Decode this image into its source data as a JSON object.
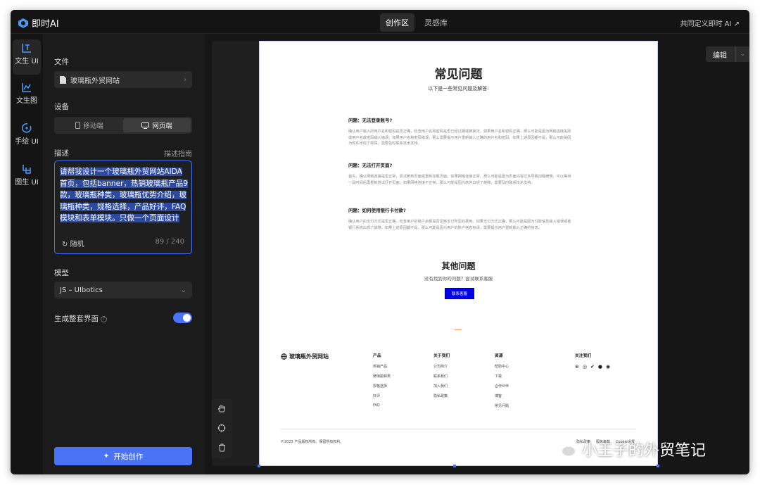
{
  "app": {
    "title": "即时AI",
    "accent": "#4a72f5"
  },
  "topbar": {
    "tabs": [
      {
        "label": "创作区",
        "active": true
      },
      {
        "label": "灵感库",
        "active": false
      }
    ],
    "right_link": "共同定义即时 AI ↗"
  },
  "nav": {
    "items": [
      {
        "label": "文生 UI",
        "icon": "text-ui-icon",
        "active": true
      },
      {
        "label": "文生图",
        "icon": "image-chart-icon",
        "active": false
      },
      {
        "label": "手绘 UI",
        "icon": "sketch-icon",
        "active": false
      },
      {
        "label": "图生 UI",
        "icon": "image-ui-icon",
        "active": false
      }
    ]
  },
  "panel": {
    "file_label": "文件",
    "file_value": "玻璃瓶外贸网站",
    "device_label": "设备",
    "device_options": [
      {
        "label": "移动端",
        "active": false
      },
      {
        "label": "网页端",
        "active": true
      }
    ],
    "desc_label": "描述",
    "desc_guide": "描述指南",
    "desc_text": "请帮我设计一个玻璃瓶外贸网站AIDA首页，包括banner，热销玻璃瓶产品9款，玻璃瓶种类，玻璃瓶优势介绍，玻璃瓶种类，规格选择，产品好评，FAQ模块和表单模块。只做一个页面设计",
    "random_label": "随机",
    "char_count": "89 / 240",
    "model_label": "模型",
    "model_value": "JS – UIbotics",
    "full_ui_label": "生成整套界面",
    "full_ui_enabled": true,
    "start_button": "开始创作"
  },
  "canvas": {
    "edit_button": "编辑",
    "tools": [
      "hand-icon",
      "target-icon",
      "trash-icon"
    ]
  },
  "preview": {
    "faq_title": "常见问题",
    "faq_subtitle": "以下是一些常见问题及解答:",
    "faqs": [
      {
        "q": "问题：无法登录账号?",
        "a": "确认用户输入的用户名和密码是否正确，检查用户名和密码是否已经过期或被锁定。如果用户名和密码正确，那么可能是因为网络连接失败或用户名或密码输入错误。如果用户名和密码错误，那么需要提示用户重新输入正确的用户名和密码。如果上述原因都不是，那么可能是因为软件出现了故障，需要及时联系技术支持。"
      },
      {
        "q": "问题：无法打开页面?",
        "a": "首先，确认网络连接是否正常，尝试刷新页面或重新加载页面。如果网络连接正常，那么可能是因为页面内容过多导致加载缓慢，可以等待一段时间后再重新尝试打开页面。如果网络连接不正常，那么可能是因为软件出现了故障，需要及时联系技术支持。"
      },
      {
        "q": "问题：如何使用银行卡付款?",
        "a": "确认用户的支付方式是否正确，检查用户的账户余额是否足够支付所需的费用。如果支付方式正确，那么可能是因为付款信息输入错误或者银行系统出现了故障。如果上述原因都不是，那么可能是因为用户的账户信息有误，需要提示用户重新输入正确的信息。"
      }
    ],
    "other_title": "其他问题",
    "other_subtitle": "没有找到你的问题？尝试联系客服",
    "contact_button": "联系客服",
    "footer_brand": "玻璃瓶外贸网站",
    "footer_cols": [
      {
        "heading": "产品",
        "items": [
          "热销产品",
          "玻璃瓶种类",
          "规格选择",
          "好评",
          "FAQ"
        ]
      },
      {
        "heading": "关于我们",
        "items": [
          "公司简介",
          "联系我们",
          "加入我们",
          "隐私政策"
        ]
      },
      {
        "heading": "资源",
        "items": [
          "帮助中心",
          "下载",
          "合作伙伴",
          "博客",
          "常见问题"
        ]
      }
    ],
    "follow_heading": "关注我们",
    "social_icons": [
      "dribbble-icon",
      "instagram-icon",
      "twitter-icon",
      "wechat-icon",
      "weibo-icon"
    ],
    "copyright": "©2023 产品版权所有。保留所有权利。",
    "legal_links": [
      "隐私政策",
      "服务条款",
      "Cookie设置"
    ]
  },
  "watermark": {
    "text": "小王子的外贸笔记"
  }
}
